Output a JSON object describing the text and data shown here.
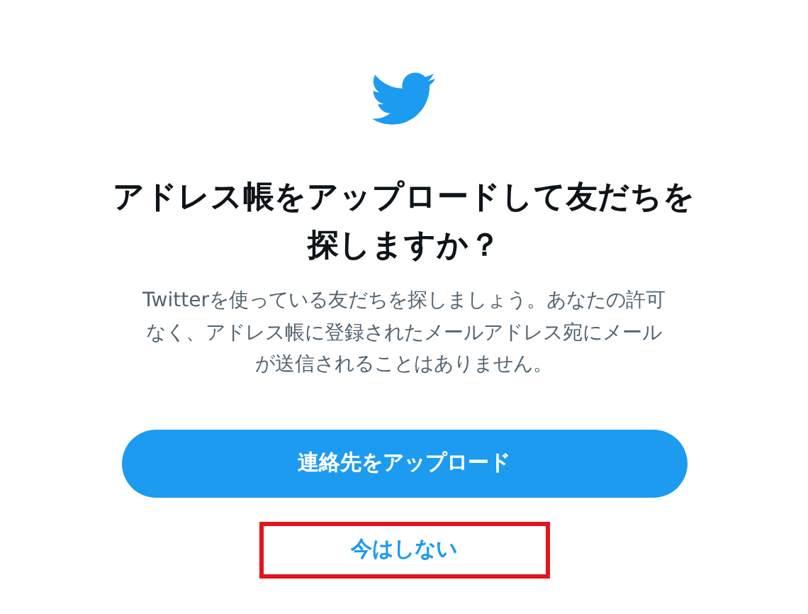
{
  "title": "アドレス帳をアップロードして友だちを探しますか？",
  "description": "Twitterを使っている友だちを探しましょう。あなたの許可なく、アドレス帳に登録されたメールアドレス宛にメールが送信されることはありません。",
  "buttons": [
    {
      "label": "連絡先をアップロード",
      "kind": "primary",
      "highlighted": false
    },
    {
      "label": "今はしない",
      "kind": "text",
      "highlighted": true
    }
  ]
}
